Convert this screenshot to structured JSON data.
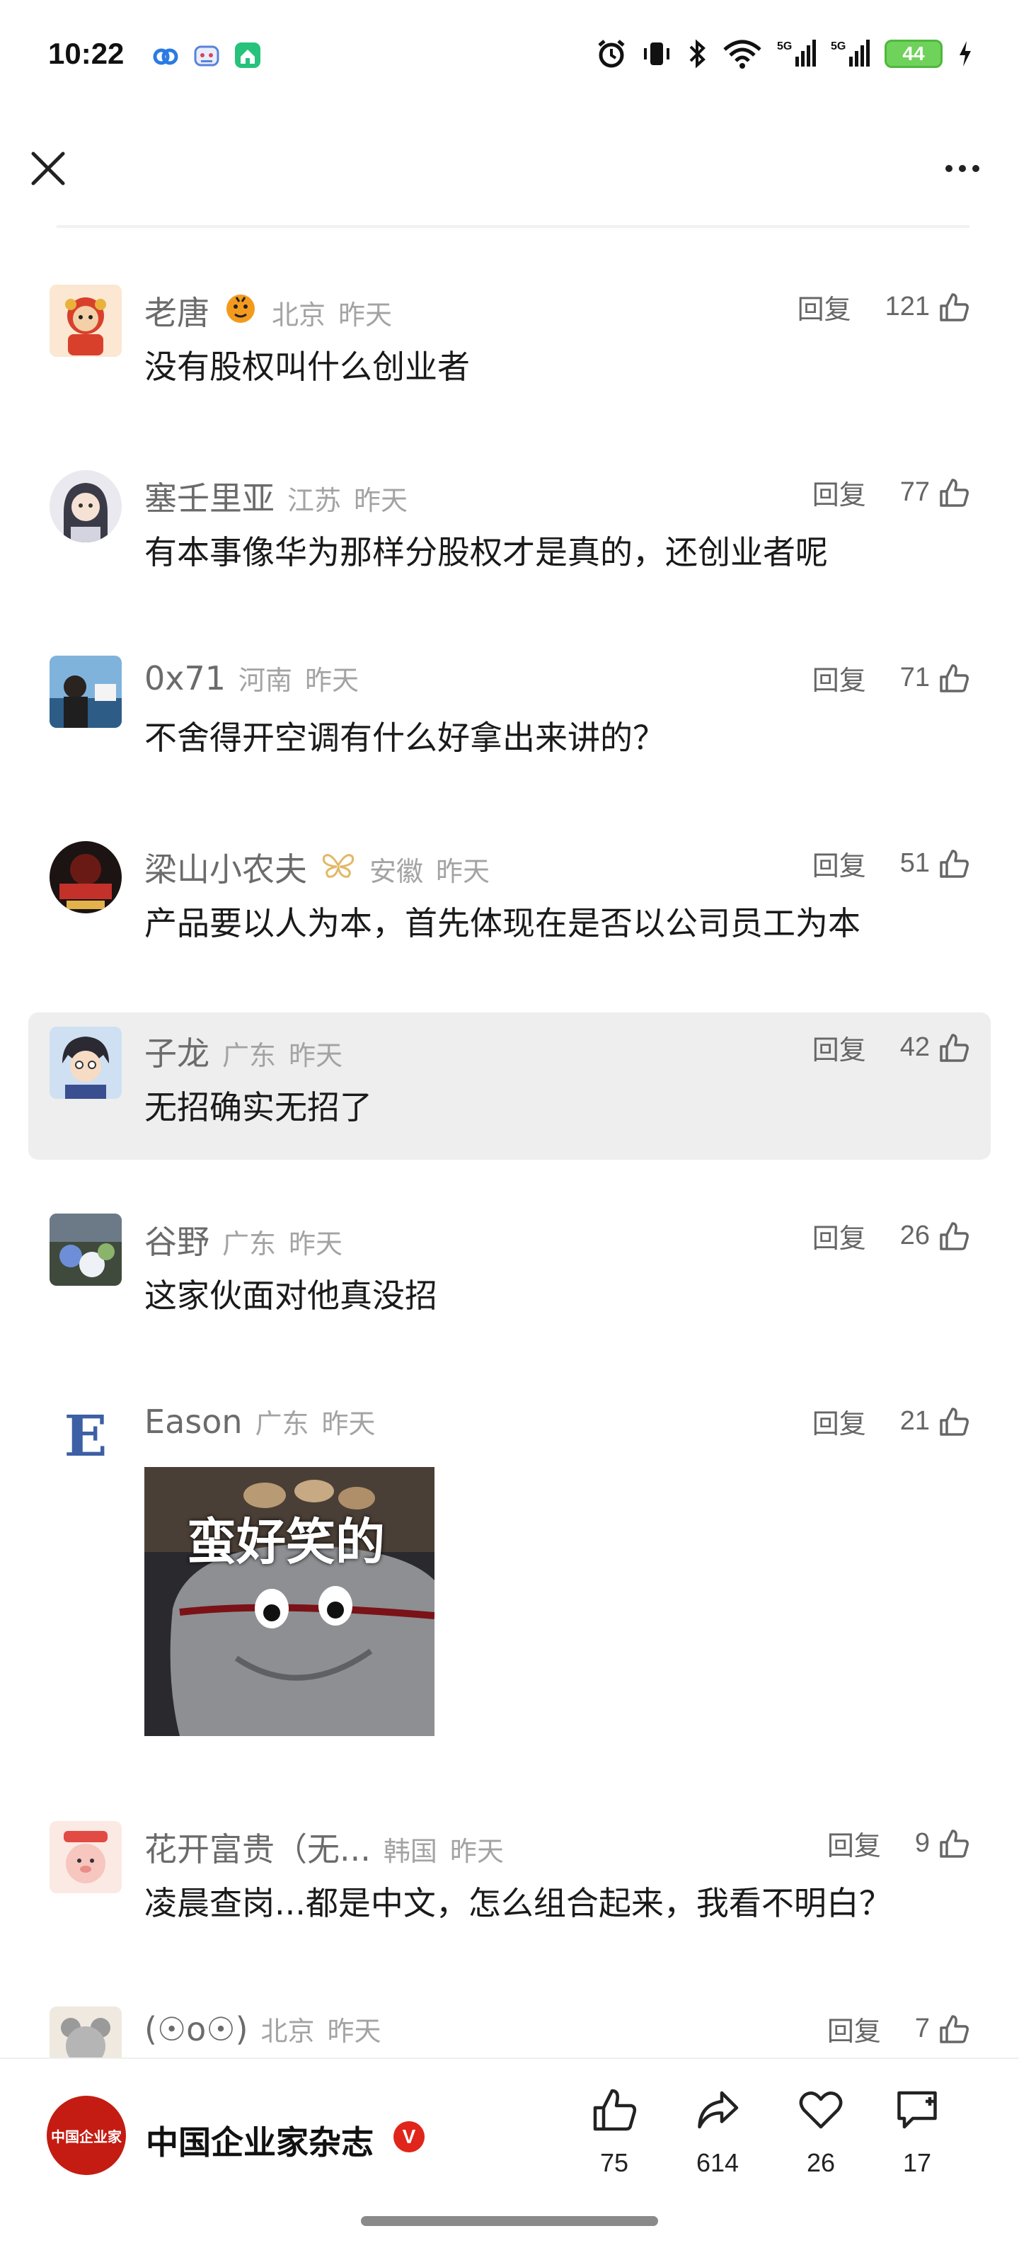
{
  "status_bar": {
    "time": "10:22",
    "battery": "44",
    "signal_labels": [
      "5G",
      "5G"
    ]
  },
  "header": {
    "close_icon": "close-icon",
    "more_icon": "more-icon"
  },
  "comments": [
    {
      "user": "老唐",
      "badge": "tiger",
      "location": "北京",
      "time": "昨天",
      "reply": "回复",
      "likes": "121",
      "text": "没有股权叫什么创业者"
    },
    {
      "user": "塞壬里亚",
      "location": "江苏",
      "time": "昨天",
      "reply": "回复",
      "likes": "77",
      "text": "有本事像华为那样分股权才是真的，还创业者呢"
    },
    {
      "user": "0x71",
      "location": "河南",
      "time": "昨天",
      "reply": "回复",
      "likes": "71",
      "text": "不舍得开空调有什么好拿出来讲的？"
    },
    {
      "user": "梁山小农夫",
      "badge": "butterfly",
      "location": "安徽",
      "time": "昨天",
      "reply": "回复",
      "likes": "51",
      "text": "产品要以人为本，首先体现在是否以公司员工为本"
    },
    {
      "user": "子龙",
      "location": "广东",
      "time": "昨天",
      "reply": "回复",
      "likes": "42",
      "text": "无招确实无招了"
    },
    {
      "user": "谷野",
      "location": "广东",
      "time": "昨天",
      "reply": "回复",
      "likes": "26",
      "text": "这家伙面对他真没招"
    },
    {
      "user": "Eason",
      "location": "广东",
      "time": "昨天",
      "reply": "回复",
      "likes": "21",
      "text": "",
      "image_caption": "蛮好笑的"
    },
    {
      "user": "花开富贵（无...",
      "location": "韩国",
      "time": "昨天",
      "reply": "回复",
      "likes": "9",
      "text": "凌晨查岗...都是中文，怎么组合起来，我看不明白？"
    },
    {
      "user": "(☉o☉)",
      "location": "北京",
      "time": "昨天",
      "reply": "回复",
      "likes": "7",
      "text": ""
    }
  ],
  "bottom_bar": {
    "publisher": "中国企业家杂志",
    "publisher_logo_text": "中国企业家",
    "verified": "V",
    "like_count": "75",
    "share_count": "614",
    "favorite_count": "26",
    "comment_count": "17"
  },
  "colors": {
    "highlight_bg": "#eeeeee",
    "accent_red": "#c41c12",
    "battery_green": "#6fd25a"
  }
}
